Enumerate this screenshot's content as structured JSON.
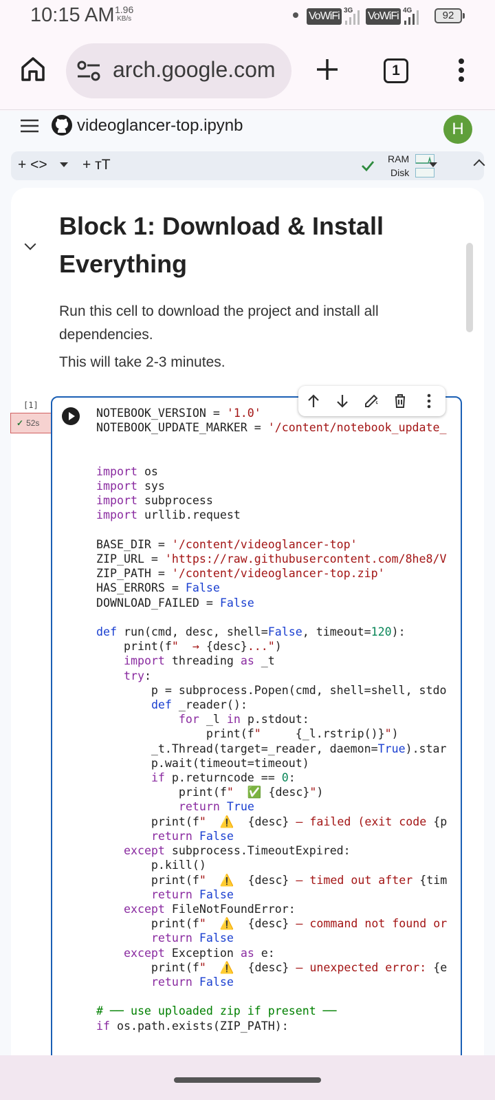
{
  "status_bar": {
    "time": "10:15 AM",
    "speed_value": "1.96",
    "speed_unit": "KB/s",
    "sim1_label": "VoWiFi",
    "sim1_net": "3G",
    "sim2_label": "VoWiFi",
    "sim2_net": "4G",
    "battery": "92"
  },
  "browser": {
    "url": "arch.google.com",
    "tab_count": "1"
  },
  "colab": {
    "notebook_title": "videoglancer-top.ipynb",
    "avatar_letter": "H",
    "toolbar": {
      "add_code": "+ <>",
      "add_text": "+ ᴛT",
      "ram_label": "RAM",
      "disk_label": "Disk"
    },
    "markdown": {
      "heading": "Block 1: Download & Install Everything",
      "paragraph1": "Run this cell to download the project and install all dependencies.",
      "paragraph2": "This will take 2-3 minutes."
    },
    "cell": {
      "execution_count": "[1]",
      "execution_time": "52s"
    }
  },
  "colors": {
    "accent_blue": "#1a5fb4",
    "keyword_purple": "#8a2ba0",
    "string_red": "#a31515",
    "comment_green": "#008000",
    "avatar_green": "#5f9f3a"
  }
}
